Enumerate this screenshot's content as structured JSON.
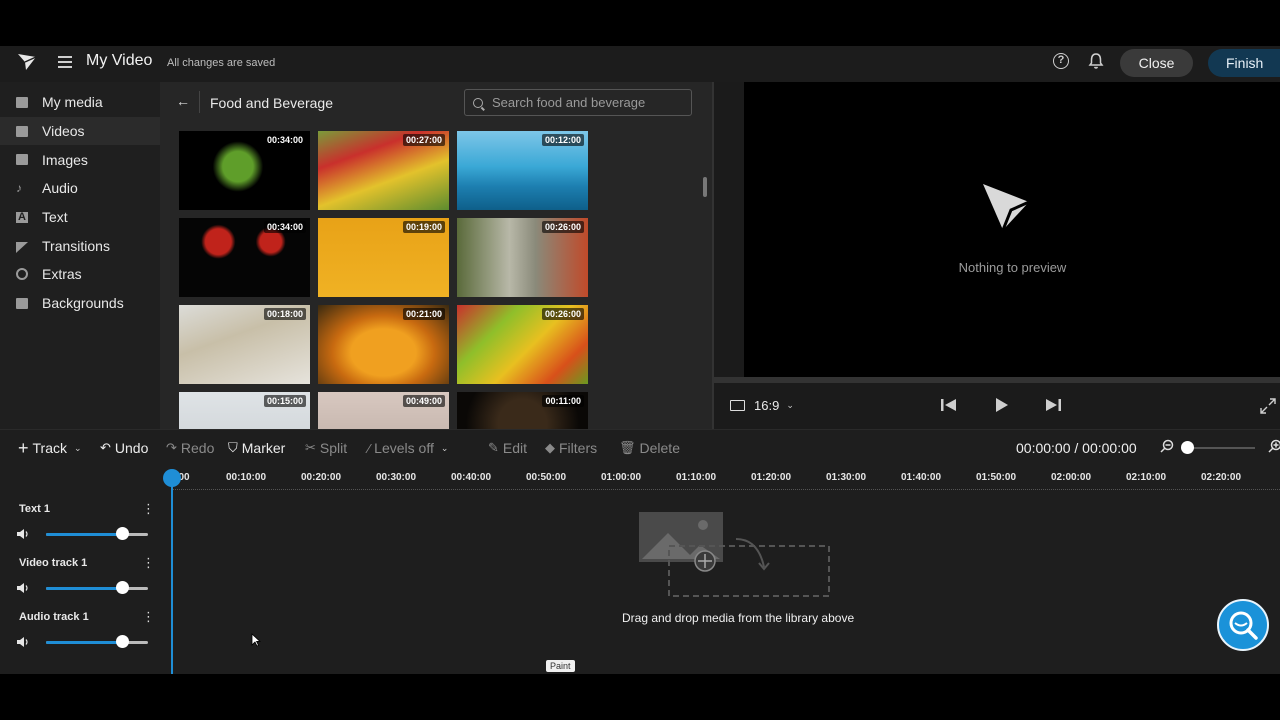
{
  "header": {
    "title": "My Video",
    "save_status": "All changes are saved",
    "close_label": "Close",
    "finish_label": "Finish"
  },
  "sidebar": {
    "items": [
      {
        "label": "My media",
        "icon": "folder-icon"
      },
      {
        "label": "Videos",
        "icon": "video-icon",
        "active": true
      },
      {
        "label": "Images",
        "icon": "image-icon"
      },
      {
        "label": "Audio",
        "icon": "music-note-icon"
      },
      {
        "label": "Text",
        "icon": "text-icon"
      },
      {
        "label": "Transitions",
        "icon": "transition-icon"
      },
      {
        "label": "Extras",
        "icon": "smiley-icon"
      },
      {
        "label": "Backgrounds",
        "icon": "backgrounds-icon"
      }
    ]
  },
  "library": {
    "title": "Food and Beverage",
    "search_placeholder": "Search food and beverage",
    "thumbnails": [
      {
        "duration": "00:34:00",
        "subject": "green apple splash"
      },
      {
        "duration": "00:27:00",
        "subject": "vegetables"
      },
      {
        "duration": "00:12:00",
        "subject": "cocktails by the sea"
      },
      {
        "duration": "00:34:00",
        "subject": "tomatoes in water"
      },
      {
        "duration": "00:19:00",
        "subject": "orange juice"
      },
      {
        "duration": "00:26:00",
        "subject": "supermarket aisle"
      },
      {
        "duration": "00:18:00",
        "subject": "squeezing lemon"
      },
      {
        "duration": "00:21:00",
        "subject": "honey jar"
      },
      {
        "duration": "00:26:00",
        "subject": "fruit pile"
      },
      {
        "duration": "00:15:00",
        "subject": "glass of milk"
      },
      {
        "duration": "00:49:00",
        "subject": "kneading dough"
      },
      {
        "duration": "00:11:00",
        "subject": "coffee beans"
      }
    ]
  },
  "preview": {
    "empty_text": "Nothing to preview",
    "aspect_ratio": "16:9"
  },
  "toolbar": {
    "track": "Track",
    "undo": "Undo",
    "redo": "Redo",
    "marker": "Marker",
    "split": "Split",
    "levels": "Levels off",
    "edit": "Edit",
    "filters": "Filters",
    "delete": "Delete",
    "timecode": "00:00:00 / 00:00:00"
  },
  "ruler": {
    "ticks": [
      "00",
      "00:10:00",
      "00:20:00",
      "00:30:00",
      "00:40:00",
      "00:50:00",
      "01:00:00",
      "01:10:00",
      "01:20:00",
      "01:30:00",
      "01:40:00",
      "01:50:00",
      "02:00:00",
      "02:10:00",
      "02:20:00"
    ]
  },
  "tracks": [
    {
      "name": "Text 1",
      "volume": 0.75
    },
    {
      "name": "Video track 1",
      "volume": 0.75
    },
    {
      "name": "Audio track 1",
      "volume": 0.75
    }
  ],
  "timeline": {
    "drop_text": "Drag and drop media from the library above",
    "tooltip": "Paint"
  },
  "colors": {
    "accent": "#1f8ed6",
    "finish_bg": "#123852",
    "help_fab": "#1a92d9"
  }
}
